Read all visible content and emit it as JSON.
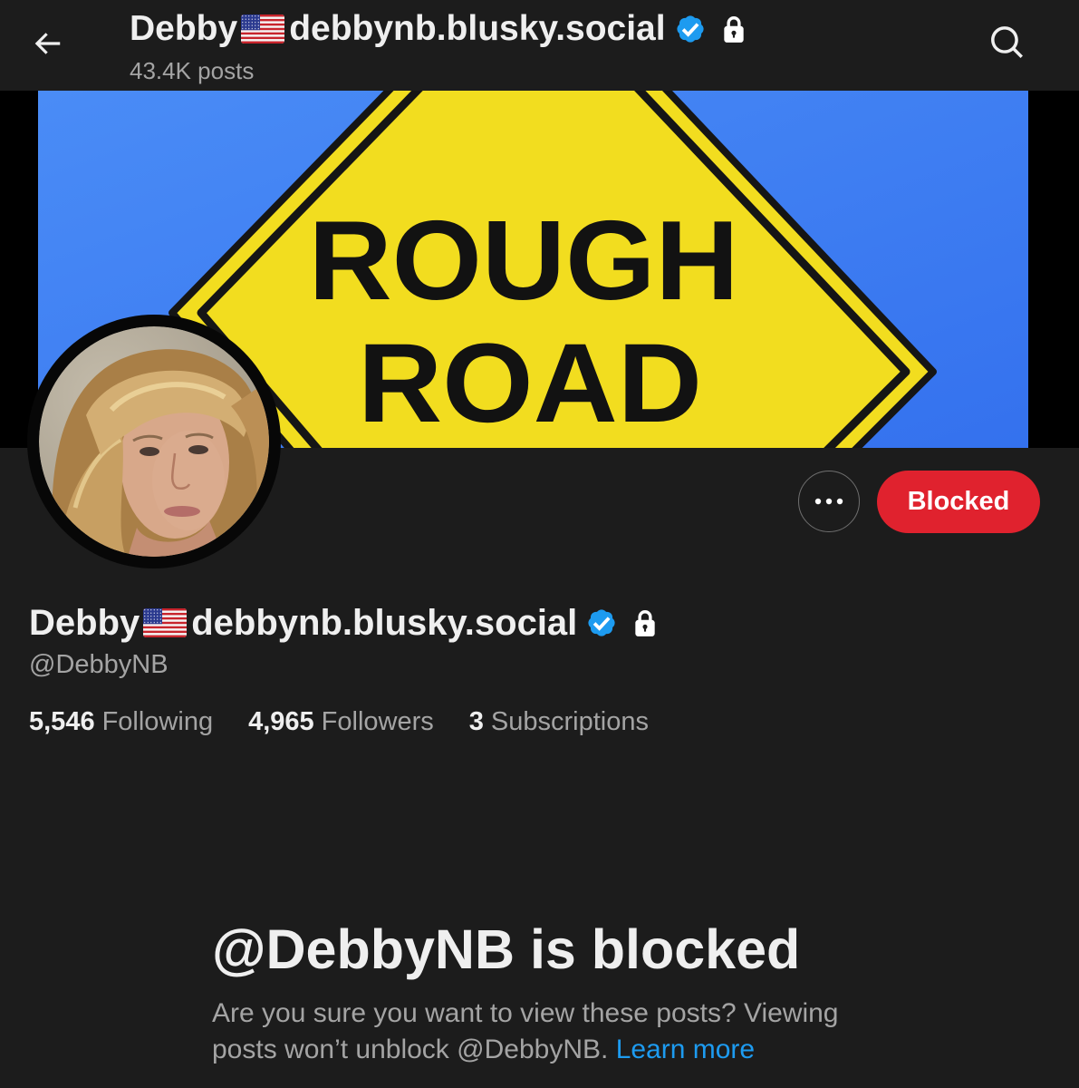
{
  "colors": {
    "page_bg": "#1c1c1c",
    "text_primary": "#efefef",
    "text_secondary": "#a4a4a4",
    "link_blue": "#1d9bf0",
    "verified_blue": "#1d9bf0",
    "blocked_red": "#e0222e",
    "border_gray": "#6f6f6f"
  },
  "icons": {
    "back": "arrow-left-icon",
    "search": "search-icon",
    "flag": "us-flag-emoji-icon",
    "verified": "verified-badge-icon",
    "protected": "lock-icon",
    "more": "more-horizontal-icon"
  },
  "header": {
    "name_part_1": "Debby",
    "name_part_2": "debbynb.blusky.social",
    "post_count": "43.4K posts"
  },
  "banner": {
    "sign_line_1": "ROUGH",
    "sign_line_2": "ROAD"
  },
  "actions": {
    "blocked_label": "Blocked"
  },
  "profile": {
    "name_part_1": "Debby",
    "name_part_2": "debbynb.blusky.social",
    "verified": true,
    "protected": true,
    "handle": "@DebbyNB",
    "stats": [
      {
        "count": "5,546",
        "label": "Following"
      },
      {
        "count": "4,965",
        "label": "Followers"
      },
      {
        "count": "3",
        "label": "Subscriptions"
      }
    ]
  },
  "blocked_notice": {
    "title": "@DebbyNB is blocked",
    "body": "Are you sure you want to view these posts? Viewing posts won’t unblock @DebbyNB.",
    "link": "Learn more"
  }
}
